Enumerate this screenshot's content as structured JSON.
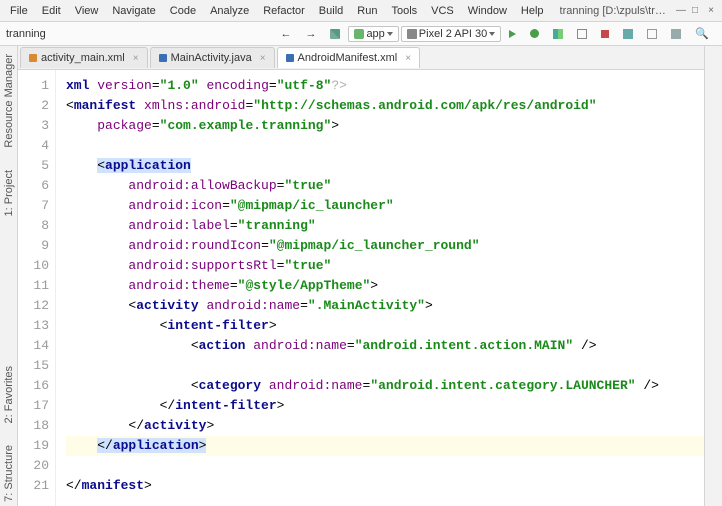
{
  "menu": {
    "items": [
      "File",
      "Edit",
      "View",
      "Navigate",
      "Code",
      "Analyze",
      "Refactor",
      "Build",
      "Run",
      "Tools",
      "VCS",
      "Window",
      "Help"
    ],
    "title": "tranning [D:\\zpuls\\tranning] - ...\\app\\src\\main\\AndroidManifest.xml [app]"
  },
  "window": {
    "min": "—",
    "max": "□",
    "close": "×"
  },
  "toolbar": {
    "crumb": "tranning",
    "back": "←",
    "fwd": "→",
    "app_combo": "app",
    "device_combo": "Pixel 2 API 30",
    "search": "🔍"
  },
  "tabs": [
    {
      "label": "activity_main.xml",
      "color": "#d88a2e",
      "active": false
    },
    {
      "label": "MainActivity.java",
      "color": "#3a6fb5",
      "active": false
    },
    {
      "label": "AndroidManifest.xml",
      "color": "#3a6fb5",
      "active": true
    }
  ],
  "side_left": [
    "Resource Manager",
    "1: Project"
  ],
  "side_left2": [
    "2: Favorites",
    "7: Structure"
  ],
  "code": {
    "l1": {
      "pi_open": "<?",
      "pi_tag": "xml",
      "a1": "version",
      "v1": "\"1.0\"",
      "a2": "encoding",
      "v2": "\"utf-8\"",
      "pi_close": "?>"
    },
    "l2": {
      "tag": "manifest",
      "a1": "xmlns:android",
      "v1": "\"http://schemas.android.com/apk/res/android\""
    },
    "l3": {
      "a1": "package",
      "v1": "\"com.example.tranning\"",
      "close": ">"
    },
    "l5": {
      "tag": "application"
    },
    "l6": {
      "a": "android:allowBackup",
      "v": "\"true\""
    },
    "l7": {
      "a": "android:icon",
      "v": "\"@mipmap/ic_launcher\""
    },
    "l8": {
      "a": "android:label",
      "v": "\"tranning\""
    },
    "l9": {
      "a": "android:roundIcon",
      "v": "\"@mipmap/ic_launcher_round\""
    },
    "l10": {
      "a": "android:supportsRtl",
      "v": "\"true\""
    },
    "l11": {
      "a": "android:theme",
      "v": "\"@style/AppTheme\"",
      "close": ">"
    },
    "l12": {
      "tag": "activity",
      "a": "android:name",
      "v": "\".MainActivity\"",
      "close": ">"
    },
    "l13": {
      "tag": "intent-filter",
      "close": ">"
    },
    "l14": {
      "tag": "action",
      "a": "android:name",
      "v": "\"android.intent.action.MAIN\"",
      "close": " />"
    },
    "l16": {
      "tag": "category",
      "a": "android:name",
      "v": "\"android.intent.category.LAUNCHER\"",
      "close": " />"
    },
    "l17": {
      "tagc": "intent-filter"
    },
    "l18": {
      "tagc": "activity"
    },
    "l19": {
      "tagc": "application"
    },
    "l21": {
      "tagc": "manifest"
    }
  },
  "gutter_lines": 21
}
